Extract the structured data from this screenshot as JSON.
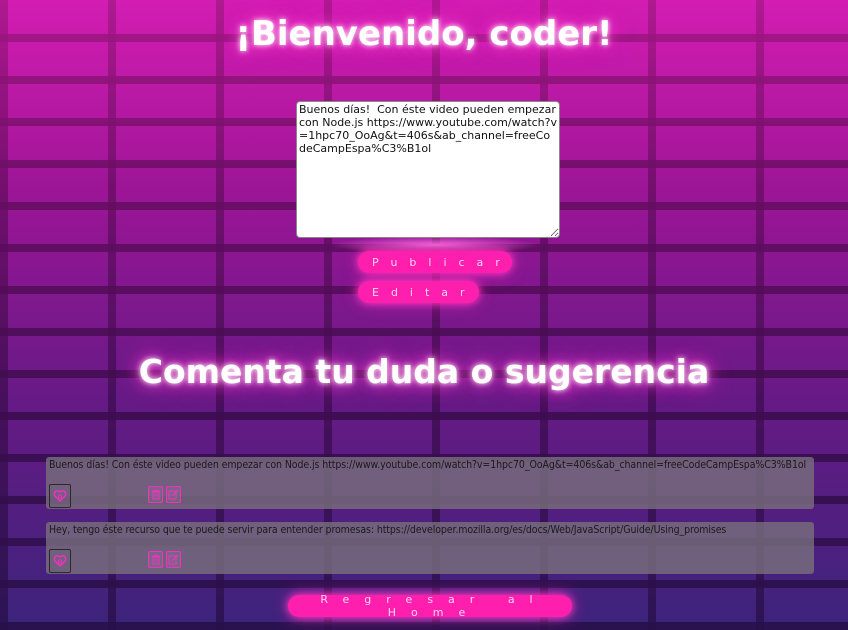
{
  "header": {
    "title": "¡Bienvenido, coder!"
  },
  "post_form": {
    "textarea_value": "Buenos días!  Con éste video pueden empezar con Node.js https://www.youtube.com/watch?v=1hpc70_OoAg&t=406s&ab_channel=freeCodeCampEspa%C3%B1ol",
    "publish_label": "Publicar",
    "edit_label": "Editar"
  },
  "comments_section": {
    "heading": "Comenta tu duda o sugerencia",
    "comments": [
      {
        "text": "Buenos días! Con éste video pueden empezar con Node.js https://www.youtube.com/watch?v=1hpc70_OoAg&t=406s&ab_channel=freeCodeCampEspa%C3%B1ol"
      },
      {
        "text": "Hey, tengo éste recurso que te puede servir para entender promesas: https://developer.mozilla.org/es/docs/Web/JavaScript/Guide/Using_promises"
      }
    ]
  },
  "footer": {
    "home_label": "Regresar al Home"
  },
  "icons": {
    "like": "heart-icon",
    "delete": "trash-icon",
    "edit": "pencil-icon"
  },
  "colors": {
    "accent": "#ff1fae",
    "glow": "#ff4fd8"
  }
}
